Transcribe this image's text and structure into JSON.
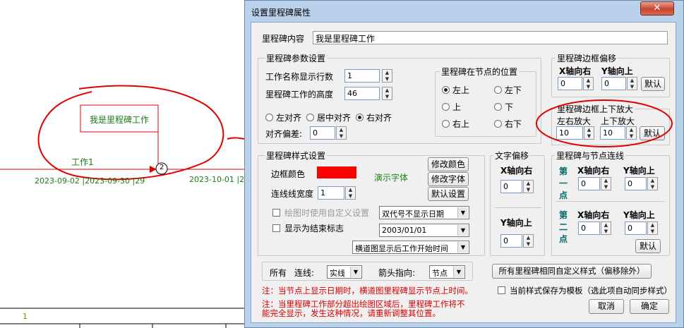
{
  "gantt": {
    "milestone_label": "我是里程碑工作",
    "work_label": "工作1",
    "node_number": "2",
    "date_text_1": "2023-09-02 |2023-09-30 |29",
    "date_text_2": "2023-10-01 |20",
    "row_number": "1",
    "colors": {
      "line": "#e00000",
      "text": "#1a7a1a",
      "annotation": "#e00000"
    }
  },
  "dialog": {
    "title": "设置里程碑属性",
    "close_glyph": "✕",
    "content_label": "里程碑内容",
    "content_value": "我是里程碑工作",
    "params": {
      "title": "里程碑参数设置",
      "rows_label": "工作名称显示行数",
      "rows_value": "1",
      "height_label": "里程碑工作的高度",
      "height_value": "46",
      "align_left": "左对齐",
      "align_center": "居中对齐",
      "align_right": "右对齐",
      "offset_label": "对齐偏差:",
      "offset_value": "0"
    },
    "node_pos": {
      "title": "里程碑在节点的位置",
      "top_left": "左上",
      "bottom_left": "左下",
      "top": "上",
      "bottom": "下",
      "top_right": "右上",
      "bottom_right": "右下"
    },
    "border_offset": {
      "title": "里程碑边框偏移",
      "x_label": "X轴向右",
      "y_label": "Y轴向上",
      "x_value": "0",
      "y_value": "0",
      "default_btn": "默认"
    },
    "border_scale": {
      "title": "里程碑边框上下放大",
      "lr_label": "左右放大",
      "ud_label": "上下放大",
      "lr_value": "10",
      "ud_value": "10",
      "default_btn": "默认"
    },
    "style": {
      "title": "里程碑样式设置",
      "border_color_label": "边框颜色",
      "border_color": "#ff0000",
      "demo_font": "演示字体",
      "modify_color_btn": "修改颜色",
      "modify_font_btn": "修改字体",
      "default_style_btn": "默认设置",
      "line_width_label": "连线线宽度",
      "line_width_value": "1",
      "custom_setting_chk": "绘图时使用自定义设置",
      "end_mark_chk": "显示为结束标志",
      "date_mode_select": "双代号不显示日期",
      "date_value_select": "2003/01/01",
      "timeline_select": "横道图显示后工作开始时间"
    },
    "text_offset": {
      "title": "文字偏移",
      "x_label": "X轴向右",
      "x_value": "0",
      "y_label": "Y轴向上",
      "y_value": "0"
    },
    "connection": {
      "title": "里程碑与节点连线",
      "first_point": "第一点",
      "second_point": "第二点",
      "x_label": "X轴向右",
      "y_label": "Y轴向上",
      "p1_x": "0",
      "p1_y": "0",
      "p2_x": "0",
      "p2_y": "0",
      "default_btn": "默认"
    },
    "bottom": {
      "all_label": "所有",
      "line_label": "连线:",
      "line_value": "实线",
      "arrow_label": "箭头指向:",
      "arrow_value": "节点",
      "all_same_btn": "所有里程碑相同自定义样式（偏移除外）",
      "save_template_chk": "当前样式保存为模板（选此项自动同步样式）",
      "note1": "注：当节点上显示日期时，横道图里程碑显示节点上时间。",
      "note2_line1": "注：当里程碑工作部分超出绘图区域后，里程碑工作将不",
      "note2_line2": "能完全显示，发生这种情况，请重新调整其位置。",
      "cancel_btn": "取消",
      "ok_btn": "确定"
    }
  }
}
